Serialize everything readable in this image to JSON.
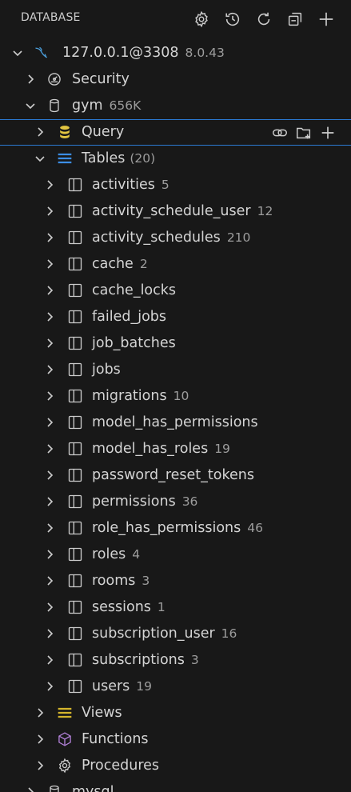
{
  "header": {
    "title": "DATABASE",
    "actions": [
      {
        "icon": "gear-icon"
      },
      {
        "icon": "history-icon"
      },
      {
        "icon": "refresh-icon"
      },
      {
        "icon": "collapse-all-icon"
      },
      {
        "icon": "add-icon"
      }
    ]
  },
  "connection": {
    "label": "127.0.0.1@3308",
    "version": "8.0.43"
  },
  "security": {
    "label": "Security"
  },
  "database": {
    "label": "gym",
    "size": "656K"
  },
  "query": {
    "label": "Query"
  },
  "tables": {
    "label": "Tables",
    "count": "(20)",
    "items": [
      {
        "name": "activities",
        "count": "5"
      },
      {
        "name": "activity_schedule_user",
        "count": "12"
      },
      {
        "name": "activity_schedules",
        "count": "210"
      },
      {
        "name": "cache",
        "count": "2"
      },
      {
        "name": "cache_locks",
        "count": ""
      },
      {
        "name": "failed_jobs",
        "count": ""
      },
      {
        "name": "job_batches",
        "count": ""
      },
      {
        "name": "jobs",
        "count": ""
      },
      {
        "name": "migrations",
        "count": "10"
      },
      {
        "name": "model_has_permissions",
        "count": ""
      },
      {
        "name": "model_has_roles",
        "count": "19"
      },
      {
        "name": "password_reset_tokens",
        "count": ""
      },
      {
        "name": "permissions",
        "count": "36"
      },
      {
        "name": "role_has_permissions",
        "count": "46"
      },
      {
        "name": "roles",
        "count": "4"
      },
      {
        "name": "rooms",
        "count": "3"
      },
      {
        "name": "sessions",
        "count": "1"
      },
      {
        "name": "subscription_user",
        "count": "16"
      },
      {
        "name": "subscriptions",
        "count": "3"
      },
      {
        "name": "users",
        "count": "19"
      }
    ]
  },
  "views": {
    "label": "Views"
  },
  "functions": {
    "label": "Functions"
  },
  "procedures": {
    "label": "Procedures"
  },
  "next_database": {
    "label": "mysql"
  },
  "colors": {
    "background": "#181818",
    "selection_border": "#2b79d1",
    "tables_icon": "#3c8ee6",
    "query_icon": "#e2c541",
    "views_icon": "#d4b52c",
    "functions_icon": "#b180d7",
    "mysql_icon": "#4a9bd6"
  }
}
